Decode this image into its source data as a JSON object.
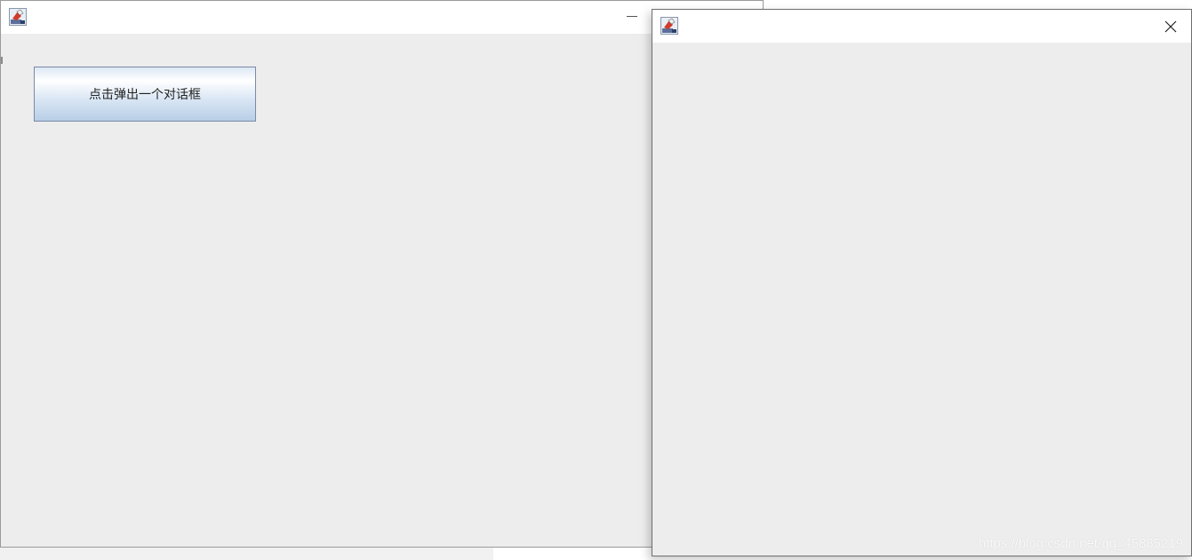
{
  "main_window": {
    "title": "",
    "button_label": "点击弹出一个对话框"
  },
  "dialog_window": {
    "title": ""
  },
  "icons": {
    "app_icon": "java-icon",
    "minimize": "minimize-icon",
    "close": "close-icon"
  },
  "watermark": "https://blog.csdn.net/qq_45885219"
}
